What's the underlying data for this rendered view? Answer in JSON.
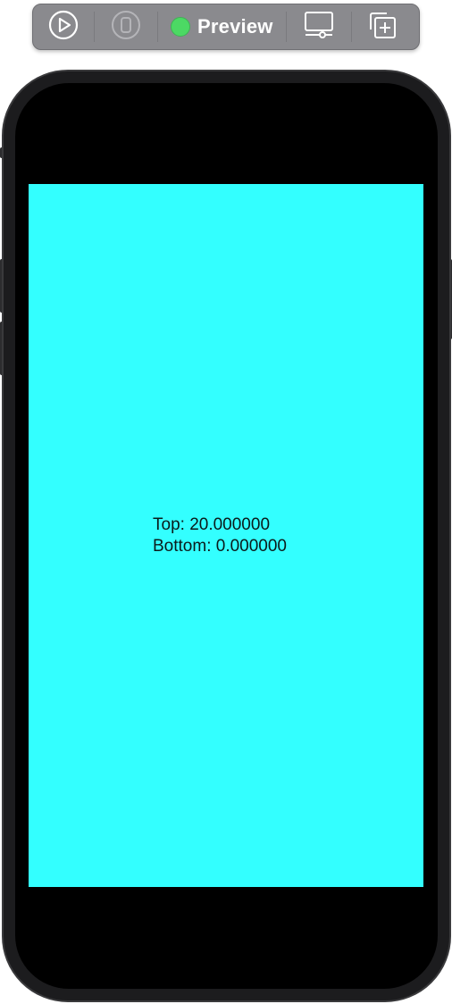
{
  "toolbar": {
    "buttons": [
      {
        "icon": "play-circle-icon",
        "enabled": true
      },
      {
        "icon": "device-icon",
        "enabled": false
      }
    ],
    "preview": {
      "status_color": "#4cd964",
      "label": "Preview"
    },
    "right_buttons": [
      {
        "icon": "device-settings-icon"
      },
      {
        "icon": "duplicate-preview-icon"
      }
    ]
  },
  "device": {
    "frame_color": "#1c1c1e",
    "screen_background": "#000000"
  },
  "content": {
    "background_color": "#33ffff",
    "top_line": "Top: 20.000000",
    "bottom_line": "Bottom: 0.000000"
  }
}
